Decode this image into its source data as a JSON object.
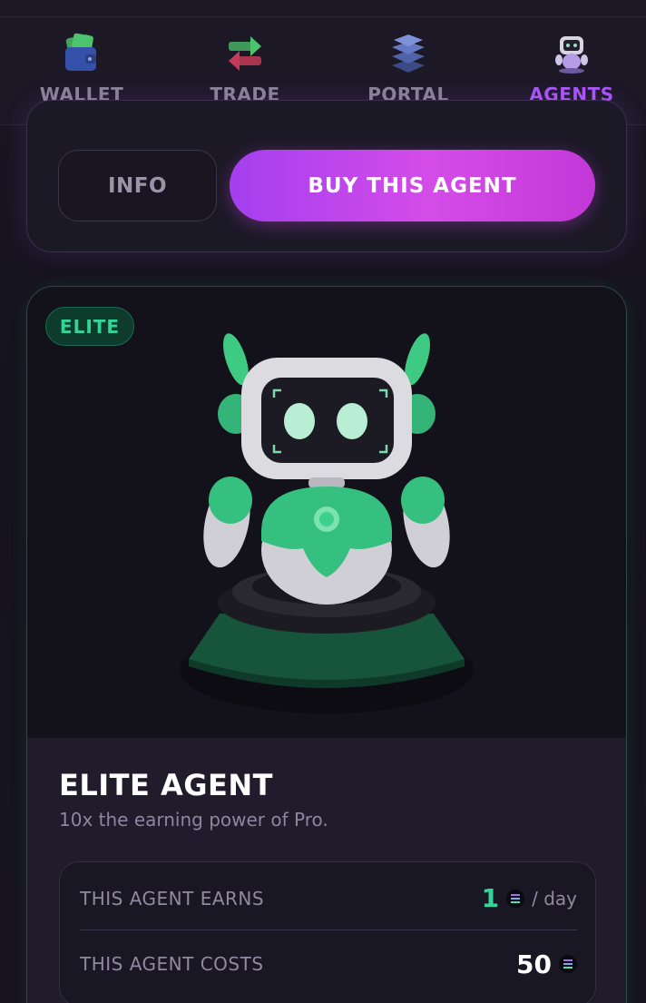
{
  "nav": {
    "items": [
      {
        "label": "WALLET",
        "icon": "wallet-icon"
      },
      {
        "label": "TRADE",
        "icon": "trade-arrows-icon"
      },
      {
        "label": "PORTAL",
        "icon": "portal-stack-icon"
      },
      {
        "label": "AGENTS",
        "icon": "robot-icon"
      }
    ],
    "active_color": "#a855f7"
  },
  "actions": {
    "info_label": "INFO",
    "buy_label": "BUY THIS AGENT"
  },
  "agent": {
    "badge": "ELITE",
    "title": "ELITE AGENT",
    "subtitle": "10x the earning power of Pro.",
    "stats": {
      "earns_label": "THIS AGENT EARNS",
      "earns_value": "1",
      "earns_unit": "/ day",
      "costs_label": "THIS AGENT COSTS",
      "costs_value": "50"
    },
    "accent_color": "#34d399"
  }
}
